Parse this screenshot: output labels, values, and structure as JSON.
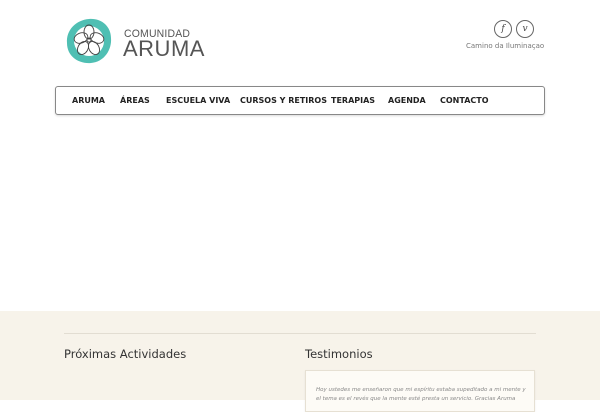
{
  "header": {
    "logo_line1": "COMUNIDAD",
    "logo_line2": "ARUMA",
    "tagline": "Camino da Iluminaçao",
    "social": [
      {
        "icon": "facebook-icon",
        "glyph": "f"
      },
      {
        "icon": "vimeo-icon",
        "glyph": "v"
      }
    ]
  },
  "nav": {
    "items": [
      "ARUMA",
      "ÁREAS",
      "ESCUELA VIVA",
      "CURSOS Y RETIROS",
      "TERAPIAS",
      "AGENDA",
      "CONTACTO"
    ]
  },
  "footer": {
    "activities_title": "Próximas Actividades",
    "testimonials_title": "Testimonios",
    "testimonial_text": "Hoy ustedes me enseñaron que mi espíritu estaba supeditado a mi mente y el tema es el revés que la mente esté presta un servicio. Gracias Aruma"
  },
  "colors": {
    "accent": "#4fbfb3",
    "footer_bg": "#f7f3ea"
  }
}
